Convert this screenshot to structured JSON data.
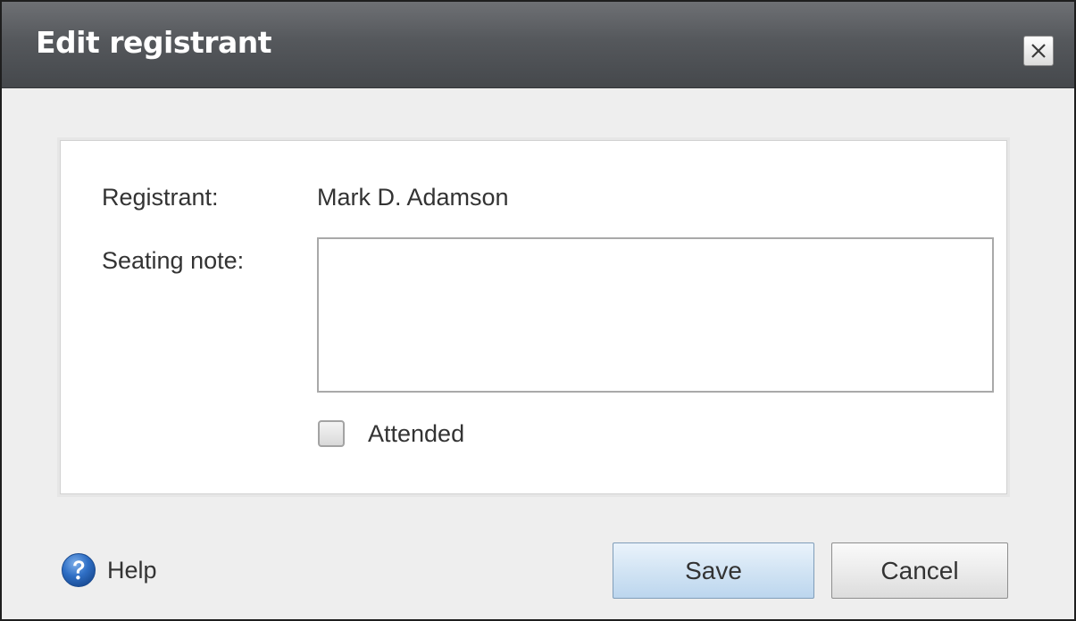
{
  "dialog": {
    "title": "Edit registrant",
    "close_icon": "close-icon"
  },
  "form": {
    "registrant_label": "Registrant:",
    "registrant_value": "Mark D. Adamson",
    "seating_note_label": "Seating note:",
    "seating_note_value": "",
    "attended_label": "Attended",
    "attended_checked": false
  },
  "footer": {
    "help_icon": "help-icon",
    "help_label": "Help",
    "save_label": "Save",
    "cancel_label": "Cancel"
  },
  "colors": {
    "titlebar": "#55585c",
    "title_text": "#ffffff",
    "help_icon_blue": "#2f6fc5",
    "save_button": "#d2e4f4"
  }
}
